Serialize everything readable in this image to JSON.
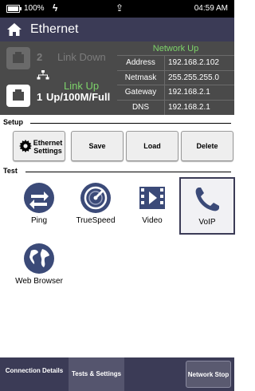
{
  "status_bar": {
    "battery_percent": "100%",
    "charging_icon": "lightning-icon",
    "usb_icon": "usb-icon",
    "time": "04:59 AM"
  },
  "header": {
    "title": "Ethernet",
    "home_icon": "home-icon"
  },
  "ports": {
    "port2": {
      "number": "2",
      "status": "Link Down"
    },
    "port1": {
      "number": "1",
      "status": "Link Up",
      "speed": "Up/100M/Full"
    }
  },
  "network": {
    "status": "Network Up",
    "rows": [
      {
        "key": "Address",
        "value": "192.168.2.102"
      },
      {
        "key": "Netmask",
        "value": "255.255.255.0"
      },
      {
        "key": "Gateway",
        "value": "192.168.2.1"
      },
      {
        "key": "DNS",
        "value": "192.168.2.1"
      }
    ]
  },
  "setup": {
    "label": "Setup",
    "buttons": {
      "ethernet_settings": "Ethernet Settings",
      "save": "Save",
      "load": "Load",
      "delete": "Delete"
    }
  },
  "test": {
    "label": "Test",
    "tiles": [
      {
        "label": "Ping",
        "icon": "ping-arrows-icon"
      },
      {
        "label": "TrueSpeed",
        "icon": "speedometer-icon"
      },
      {
        "label": "Video",
        "icon": "film-icon"
      },
      {
        "label": "VoIP",
        "icon": "phone-icon"
      },
      {
        "label": "Web Browser",
        "icon": "globe-icon"
      }
    ],
    "selected": "VoIP"
  },
  "footer": {
    "connection_details": "Connection Details",
    "tests_settings": "Tests & Settings",
    "network_stop": "Network Stop"
  },
  "colors": {
    "header_bg": "#3b3b56",
    "panel_bg": "#4a4a4a",
    "accent_green": "#7dd36a",
    "icon_blue": "#3b4a78"
  }
}
